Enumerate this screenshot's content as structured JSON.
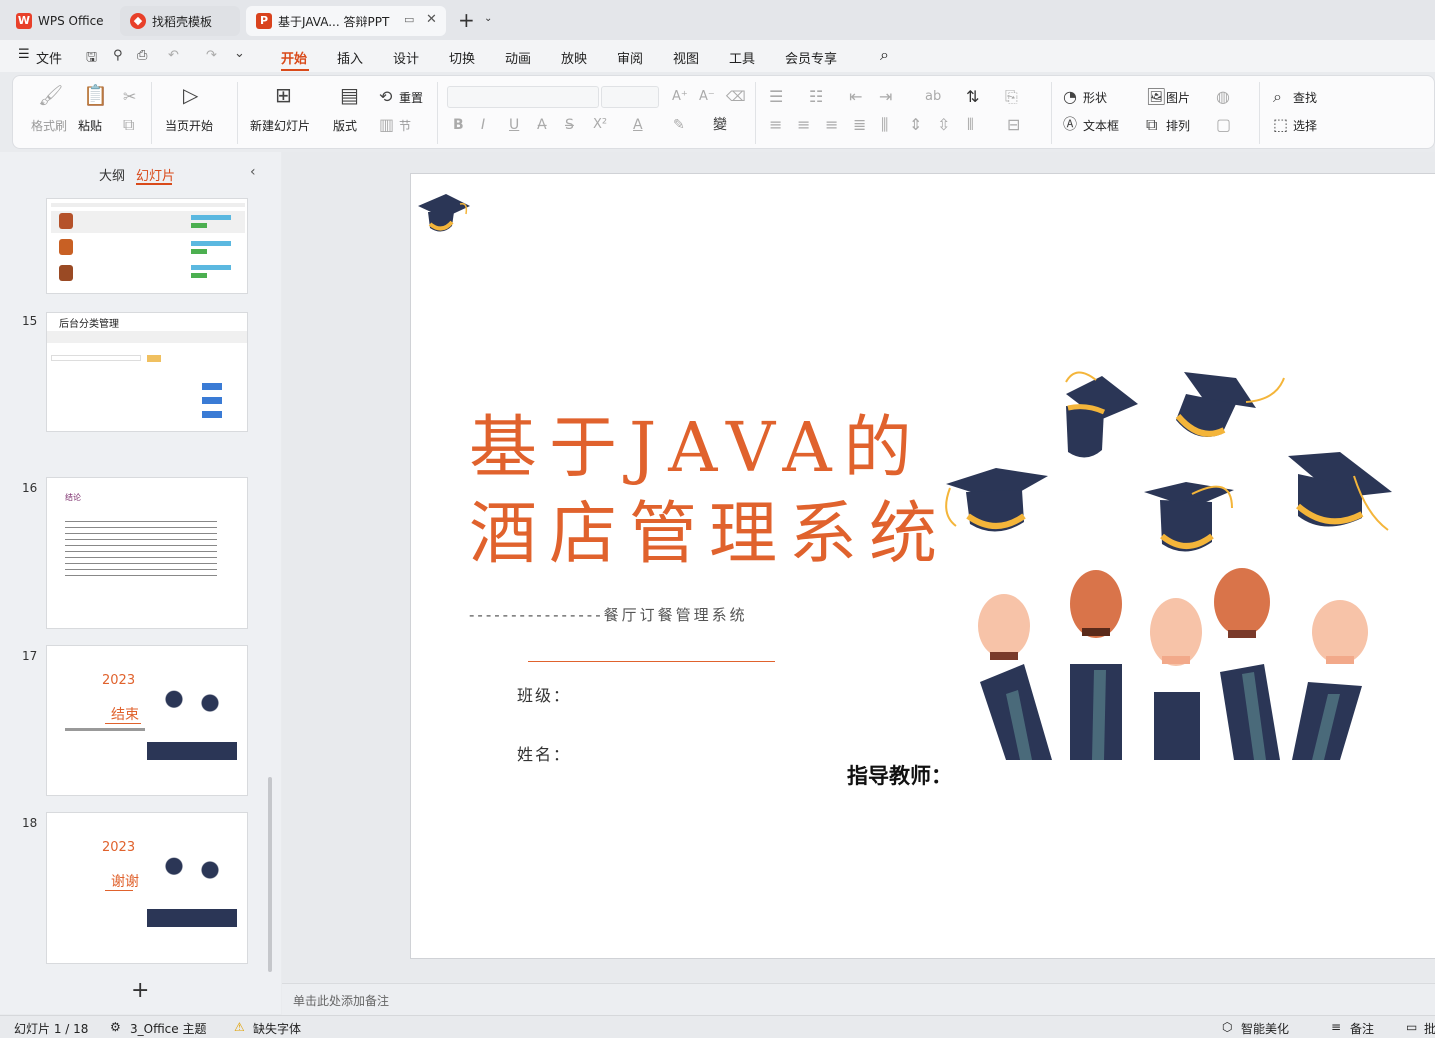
{
  "tabs": [
    {
      "label": "WPS Office",
      "icon": "wps-logo-icon"
    },
    {
      "label": "找稻壳模板",
      "icon": "docer-icon"
    },
    {
      "label": "基于JAVA... 答辩PPT",
      "icon": "ppt-file-icon"
    }
  ],
  "menu": {
    "file": "文件",
    "items": [
      "开始",
      "插入",
      "设计",
      "切换",
      "动画",
      "放映",
      "审阅",
      "视图",
      "工具",
      "会员专享"
    ],
    "active": "开始"
  },
  "ribbon": {
    "format_painter": "格式刷",
    "paste": "粘贴",
    "from_current": "当页开始",
    "new_slide": "新建幻灯片",
    "layout": "版式",
    "reset": "重置",
    "section": "节",
    "shape": "形状",
    "picture": "图片",
    "textbox": "文本框",
    "arrange": "排列",
    "find": "查找",
    "select": "选择"
  },
  "panel": {
    "outline_tab": "大纲",
    "slides_tab": "幻灯片",
    "slide_numbers": [
      "15",
      "16",
      "17",
      "18"
    ],
    "thumb15_title": "后台分类管理",
    "thumb16_title": "结论",
    "thumb17_year": "2023",
    "thumb17_text": "结束",
    "thumb18_year": "2023",
    "thumb18_text": "谢谢",
    "add_slide": "+"
  },
  "slide": {
    "title_line1": "基于JAVA的",
    "title_line2": "酒店管理系统",
    "subtitle": "----------------餐厅订餐管理系统",
    "class_label": "班级：",
    "name_label": "姓名：",
    "teacher_label": "指导教师："
  },
  "notes_placeholder": "单击此处添加备注",
  "status": {
    "slide_counter": "幻灯片 1 / 18",
    "theme": "3_Office 主题",
    "missing_font": "缺失字体",
    "smart_beautify": "智能美化",
    "notes": "备注",
    "comment": "批"
  },
  "colors": {
    "accent": "#d94a1a",
    "title": "#e0622d",
    "navy": "#2b3656",
    "gold": "#f4b53a"
  }
}
